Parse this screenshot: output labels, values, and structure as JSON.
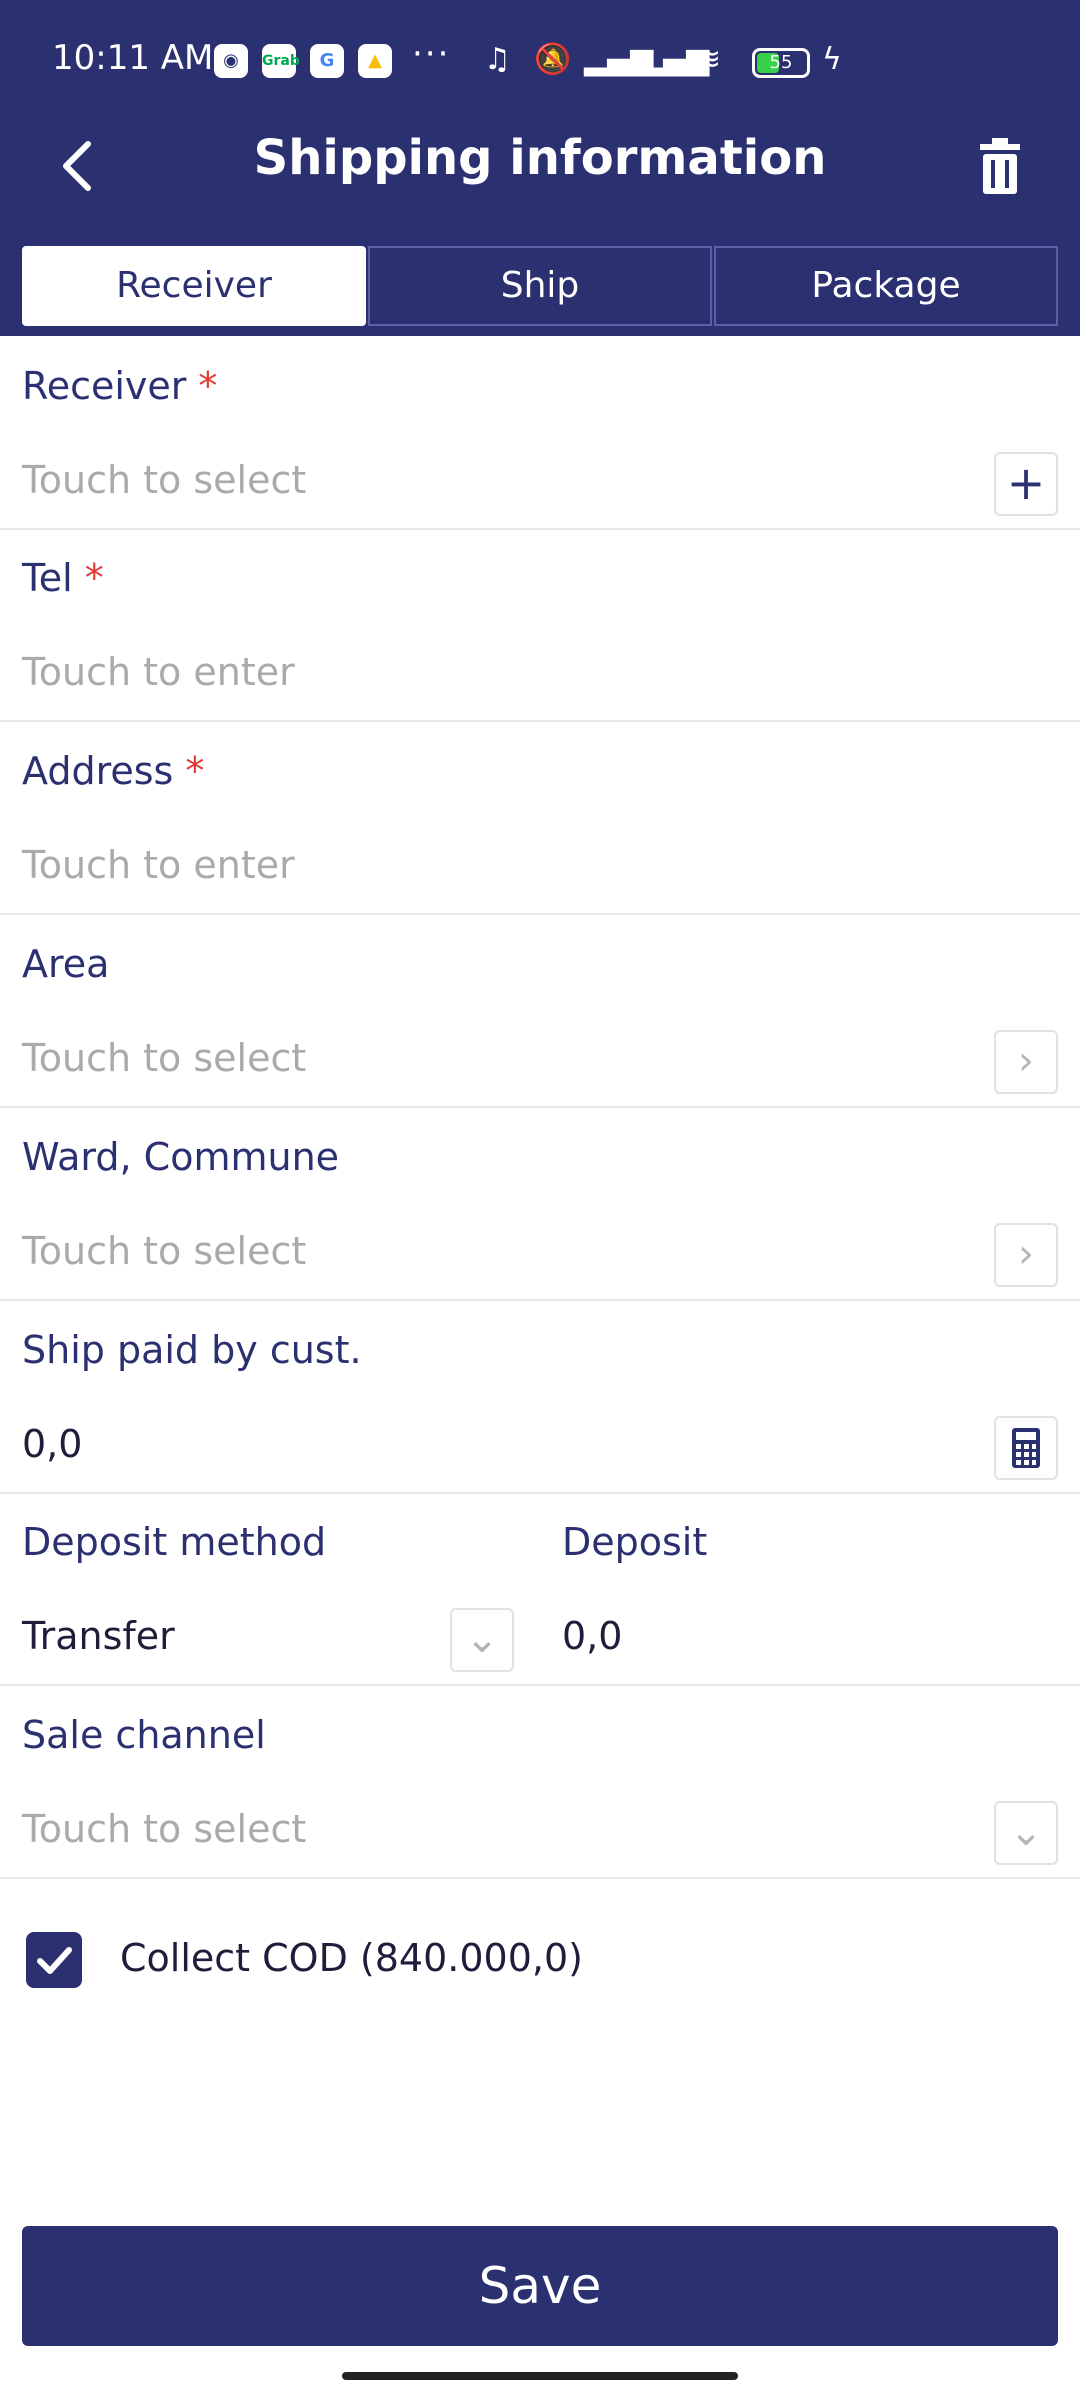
{
  "status_bar": {
    "time": "10:11 AM",
    "apps": [
      "Grab"
    ],
    "more": "···",
    "battery": "55",
    "icons": [
      "music-note-icon",
      "bell-off-icon",
      "signal-icon",
      "signal-icon",
      "wifi-icon",
      "charging-icon"
    ]
  },
  "app_bar": {
    "title": "Shipping information",
    "back_icon": "chevron-left-icon",
    "delete_icon": "trash-icon"
  },
  "tabs": [
    {
      "label": "Receiver",
      "active": true
    },
    {
      "label": "Ship",
      "active": false
    },
    {
      "label": "Package",
      "active": false
    }
  ],
  "form": {
    "receiver": {
      "label": "Receiver",
      "required_mark": "*",
      "placeholder": "Touch to select",
      "action_icon": "plus-icon"
    },
    "tel": {
      "label": "Tel",
      "required_mark": "*",
      "placeholder": "Touch to enter"
    },
    "address": {
      "label": "Address",
      "required_mark": "*",
      "placeholder": "Touch to enter"
    },
    "area": {
      "label": "Area",
      "placeholder": "Touch to select",
      "action_icon": "chevron-right-icon"
    },
    "ward": {
      "label": "Ward, Commune",
      "placeholder": "Touch to select",
      "action_icon": "chevron-right-icon"
    },
    "ship_paid": {
      "label": "Ship paid by cust.",
      "value": "0,0",
      "action_icon": "calculator-icon"
    },
    "deposit_method": {
      "label": "Deposit method",
      "value": "Transfer",
      "action_icon": "chevron-down-icon"
    },
    "deposit": {
      "label": "Deposit",
      "value": "0,0"
    },
    "sale_channel": {
      "label": "Sale channel",
      "placeholder": "Touch to select",
      "action_icon": "chevron-down-icon"
    },
    "collect_cod": {
      "label": "Collect COD (840.000,0)",
      "checked": true
    }
  },
  "actions": {
    "save_label": "Save"
  },
  "colors": {
    "primary": "#2b3070",
    "required": "#e53935",
    "placeholder": "#aaaaaa"
  }
}
